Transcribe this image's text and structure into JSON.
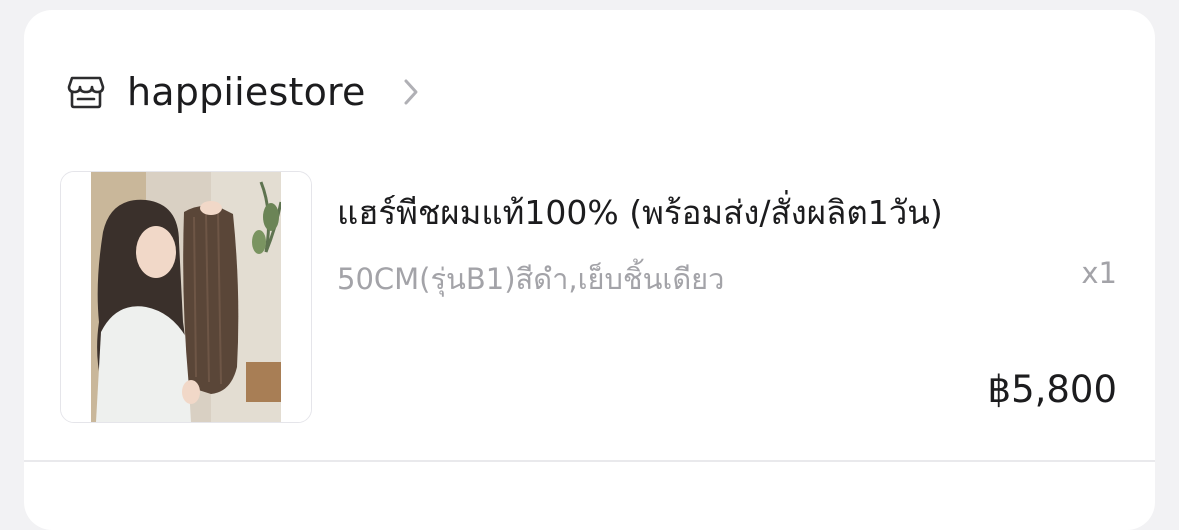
{
  "shop": {
    "name": "happiiestore",
    "icon": "storefront-icon",
    "chevron_icon": "chevron-right-icon"
  },
  "item": {
    "title": "แฮร์พีชผมแท้100% (พร้อมส่ง/สั่งผลิต1วัน)",
    "variant": "50CM(รุ่นB1)สีดำ,เย็บชิ้นเดียว",
    "quantity": "x1",
    "price": "฿5,800",
    "image_icon": "product-photo"
  },
  "colors": {
    "background": "#f2f2f4",
    "card": "#ffffff",
    "text_primary": "#1c1c1e",
    "text_secondary": "#a3a3a8"
  }
}
